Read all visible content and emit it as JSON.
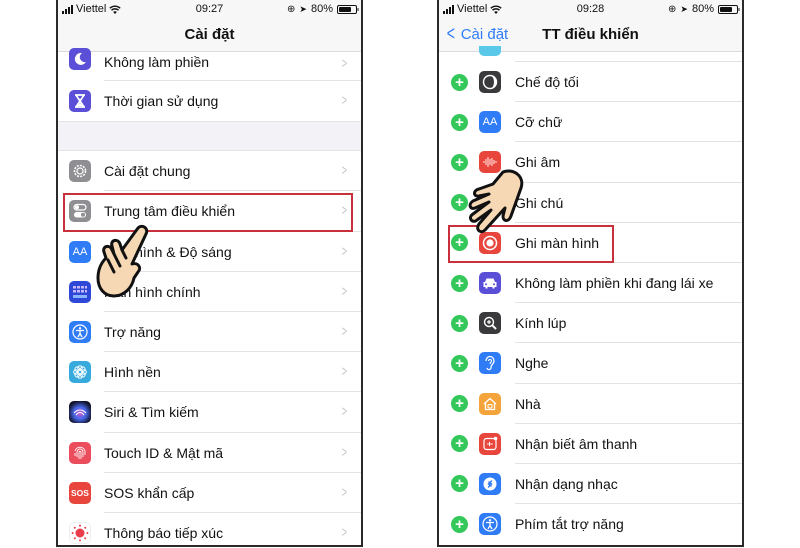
{
  "left_phone": {
    "status_bar": {
      "carrier": "Viettel",
      "time": "09:27",
      "battery": "80%",
      "battery_level": 0.8
    },
    "nav_title": "Cài đặt",
    "section1": [
      {
        "label": "Không làm phiền",
        "icon": "moon-icon",
        "color": "#5b4fd8"
      },
      {
        "label": "Thời gian sử dụng",
        "icon": "hourglass-icon",
        "color": "#5b4fd8"
      }
    ],
    "section2": [
      {
        "label": "Cài đặt chung",
        "icon": "gear-icon",
        "color": "#8e8e93"
      },
      {
        "label": "Trung tâm điều khiển",
        "icon": "toggle-switches-icon",
        "color": "#8e8e93",
        "highlighted": true
      },
      {
        "label": "Màn hình & Độ sáng",
        "icon": "text-size-icon",
        "color": "#2f7cf6"
      },
      {
        "label": "Màn hình chính",
        "icon": "home-grid-icon",
        "color": "#2d48d6"
      },
      {
        "label": "Trợ năng",
        "icon": "accessibility-icon",
        "color": "#2f7cf6"
      },
      {
        "label": "Hình nền",
        "icon": "flower-icon",
        "color": "#36aadc"
      },
      {
        "label": "Siri & Tìm kiếm",
        "icon": "siri-icon",
        "color": "#1c1c3a"
      },
      {
        "label": "Touch ID & Mật mã",
        "icon": "fingerprint-icon",
        "color": "#eb4d5d"
      },
      {
        "label": "SOS khẩn cấp",
        "icon": "sos-icon",
        "color": "#e8453c"
      },
      {
        "label": "Thông báo tiếp xúc",
        "icon": "exposure-icon",
        "color": "#ffffff"
      }
    ],
    "sos_text": "SOS",
    "aa_text": "AA"
  },
  "right_phone": {
    "status_bar": {
      "carrier": "Viettel",
      "time": "09:28",
      "battery": "80%",
      "battery_level": 0.8
    },
    "back_label": "Cài đặt",
    "nav_title": "TT điều khiển",
    "items": [
      {
        "label": "Chế độ tối",
        "icon": "dark-mode-icon",
        "color": "#3a3a3c"
      },
      {
        "label": "Cỡ chữ",
        "icon": "text-size-icon",
        "color": "#2f7cf6"
      },
      {
        "label": "Ghi âm",
        "icon": "voice-memo-icon",
        "color": "#e8453c"
      },
      {
        "label": "Ghi chú",
        "icon": "notes-icon",
        "color": "#f5c33b"
      },
      {
        "label": "Ghi màn hình",
        "icon": "screen-record-icon",
        "color": "#e8453c",
        "highlighted": true
      },
      {
        "label": "Không làm phiền khi đang lái xe",
        "icon": "car-icon",
        "color": "#5b4fd8"
      },
      {
        "label": "Kính lúp",
        "icon": "magnifier-icon",
        "color": "#3a3a3c"
      },
      {
        "label": "Nghe",
        "icon": "ear-icon",
        "color": "#2f7cf6"
      },
      {
        "label": "Nhà",
        "icon": "home-icon",
        "color": "#f5a33b"
      },
      {
        "label": "Nhận biết âm thanh",
        "icon": "sound-recognition-icon",
        "color": "#e8453c"
      },
      {
        "label": "Nhận dạng nhạc",
        "icon": "shazam-icon",
        "color": "#2f7cf6"
      },
      {
        "label": "Phím tắt trợ năng",
        "icon": "accessibility-icon",
        "color": "#2f7cf6"
      }
    ],
    "add_symbol": "+",
    "aa_text": "AA"
  },
  "colors": {
    "highlight": "#c8313c",
    "ios_blue": "#2f7cf6",
    "add_green": "#34c759",
    "hand_fill": "#f6d9b4"
  }
}
